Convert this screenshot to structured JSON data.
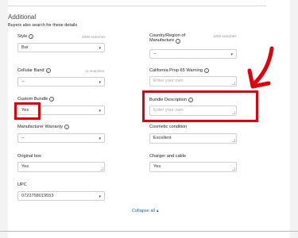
{
  "section": {
    "title": "Additional",
    "subtitle": "Buyers also search for these details"
  },
  "fields": {
    "style": {
      "label": "Style",
      "hint": "4000 searches",
      "value": "Bar"
    },
    "country": {
      "label_line1": "Country/Region of",
      "label_line2": "Manufacture",
      "hint": "1250 searches",
      "value": "--"
    },
    "cellular": {
      "label": "Cellular Band",
      "hint": "11 searches",
      "value": "--"
    },
    "prop65": {
      "label": "California Prop 65 Warning",
      "placeholder": "Enter your own"
    },
    "custom_bundle": {
      "label": "Custom Bundle",
      "value": "Yes"
    },
    "bundle_desc": {
      "label": "Bundle Description",
      "placeholder": "Enter your own"
    },
    "warranty": {
      "label": "Manufacturer Warranty",
      "value": "--"
    },
    "cosmetic": {
      "label": "Cosmetic condition",
      "value": "Excellent"
    },
    "original_box": {
      "label": "Original box",
      "value": "Yes"
    },
    "charger": {
      "label": "Charger and cable",
      "value": "Yes"
    },
    "upc": {
      "label": "UPC",
      "value": "0723758019553"
    }
  },
  "collapse_label": "Collapse all",
  "accent_colors": {
    "annotation": "#e0000b",
    "link": "#1a5fb4"
  }
}
